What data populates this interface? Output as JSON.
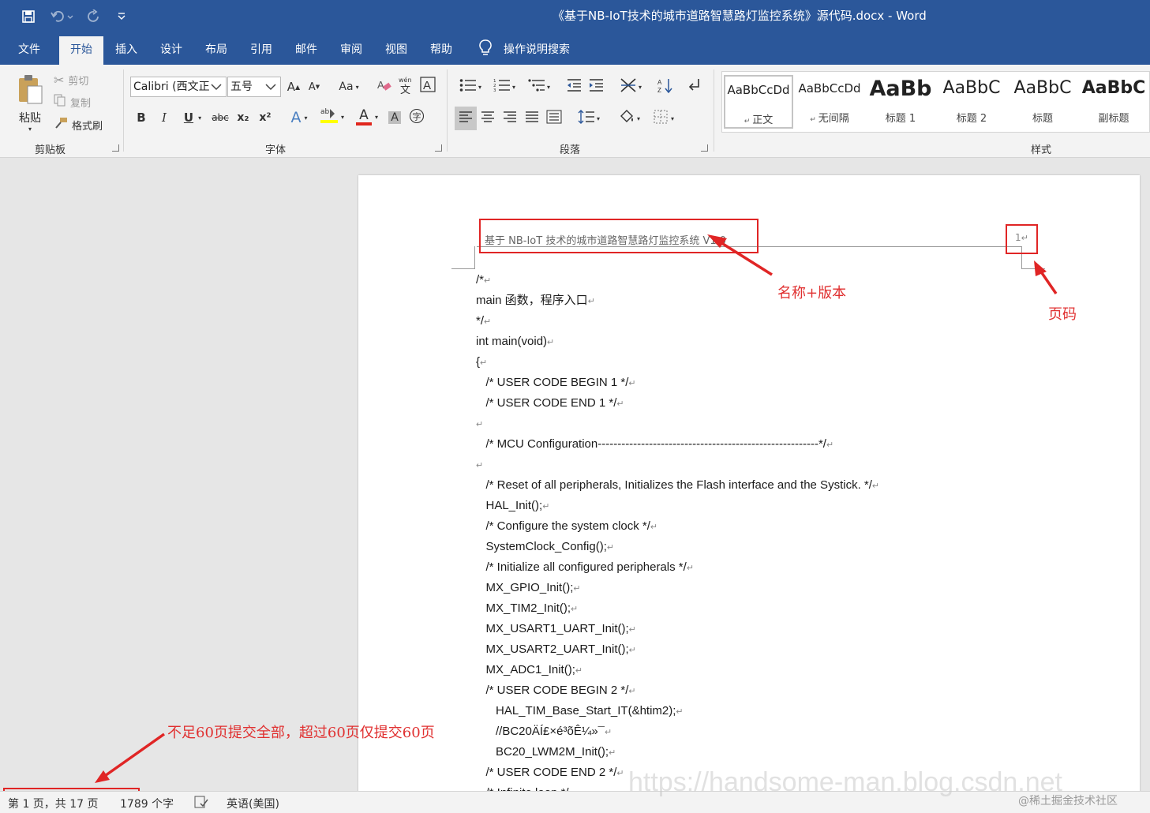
{
  "app": {
    "title": "《基于NB-IoT技术的城市道路智慧路灯监控系统》源代码.docx  -  Word"
  },
  "quick_access": {
    "save_icon": "save-icon",
    "undo_icon": "undo-icon",
    "redo_icon": "redo-icon",
    "customize_icon": "customize-qat-icon"
  },
  "tabs": [
    "文件",
    "开始",
    "插入",
    "设计",
    "布局",
    "引用",
    "邮件",
    "审阅",
    "视图",
    "帮助"
  ],
  "active_tab": "开始",
  "tell_me": "操作说明搜索",
  "clipboard": {
    "paste": "粘贴",
    "cut": "剪切",
    "copy": "复制",
    "format_painter": "格式刷",
    "label": "剪贴板"
  },
  "font": {
    "font_name": "Calibri (西文正",
    "font_size": "五号",
    "grow": "A",
    "shrink": "A",
    "change_case": "Aa",
    "bold": "B",
    "italic": "I",
    "underline": "U",
    "strike": "abc",
    "subscript": "x₂",
    "superscript": "x²",
    "text_effects": "A",
    "font_color": "A",
    "char_shading": "A",
    "label": "字体"
  },
  "paragraph": {
    "label": "段落"
  },
  "styles": {
    "label": "样式",
    "items": [
      {
        "sample": "AaBbCcDd",
        "name": "正文"
      },
      {
        "sample": "AaBbCcDd",
        "name": "无间隔"
      },
      {
        "sample": "AaBb",
        "name": "标题 1"
      },
      {
        "sample": "AaBbC",
        "name": "标题 2"
      },
      {
        "sample": "AaBbC",
        "name": "标题"
      },
      {
        "sample": "AaBbC",
        "name": "副标题"
      }
    ]
  },
  "document": {
    "header_text": "基于 NB-IoT 技术的城市道路智慧路灯监控系统 V1.0",
    "page_number": "1",
    "code_lines": [
      "/*",
      "main 函数，程序入口",
      "*/",
      "int main(void)",
      "{",
      "   /* USER CODE BEGIN 1 */",
      "   /* USER CODE END 1 */",
      "",
      "   /* MCU Configuration--------------------------------------------------------*/",
      "",
      "   /* Reset of all peripherals, Initializes the Flash interface and the Systick. */",
      "   HAL_Init();",
      "   /* Configure the system clock */",
      "   SystemClock_Config();",
      "   /* Initialize all configured peripherals */",
      "   MX_GPIO_Init();",
      "   MX_TIM2_Init();",
      "   MX_USART1_UART_Init();",
      "   MX_USART2_UART_Init();",
      "   MX_ADC1_Init();",
      "   /* USER CODE BEGIN 2 */",
      "      HAL_TIM_Base_Start_IT(&htim2);",
      "      //BC20ÄÍ£×é³õÊ¼»¯",
      "      BC20_LWM2M_Init();",
      "   /* USER CODE END 2 */",
      "   /* Infinite loop */"
    ]
  },
  "annotations": {
    "name_version": "名称+版本",
    "page_code": "页码",
    "submit_rule": "不足60页提交全部，超过60页仅提交60页",
    "color": "#e02525"
  },
  "statusbar": {
    "page_info": "第 1 页，共 17 页",
    "word_count": "1789 个字",
    "language": "英语(美国)"
  },
  "watermark": {
    "text": "@稀土掘金技术社区",
    "url": "https://handsome-man.blog.csdn.net"
  },
  "colors": {
    "accent": "#2b579a",
    "ribbon_bg": "#f3f3f3",
    "doc_bg": "#e6e6e6"
  }
}
